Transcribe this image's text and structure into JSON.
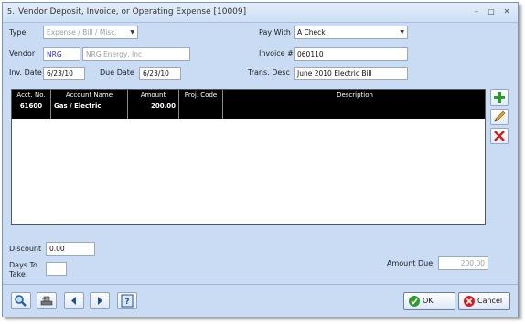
{
  "window": {
    "title": "Vendor Deposit, Invoice, or Operating Expense [10009]",
    "app_icon_glyph": "5.",
    "min_glyph": "–",
    "max_glyph": "□",
    "close_glyph": "✕"
  },
  "form": {
    "type_label": "Type",
    "type_value": "Expense / Bill / Misc.",
    "vendor_label": "Vendor",
    "vendor_code": "NRG",
    "vendor_name": "NRG Energy, Inc",
    "inv_date_label": "Inv. Date",
    "inv_date": "6/23/10",
    "due_date_label": "Due Date",
    "due_date": "6/23/10",
    "pay_with_label": "Pay With",
    "pay_with_value": "A Check",
    "invoice_label": "Invoice #",
    "invoice_value": "060110",
    "trans_desc_label": "Trans. Desc",
    "trans_desc_value": "June 2010 Electric Bill"
  },
  "grid": {
    "columns": [
      "Acct. No.",
      "Account Name",
      "Amount",
      "Proj. Code",
      "Description"
    ],
    "rows": [
      {
        "acct_no": "61600",
        "account_name": "Gas / Electric",
        "amount": "200.00",
        "proj_code": "",
        "description": ""
      }
    ]
  },
  "bottom": {
    "discount_label": "Discount",
    "discount_value": "0.00",
    "days_label_1": "Days To",
    "days_label_2": "Take",
    "days_value": "",
    "amount_due_label": "Amount Due",
    "amount_due_value": "200.00"
  },
  "buttons": {
    "ok_label": "OK",
    "cancel_label": "Cancel"
  },
  "icons": {
    "add": "add-row-icon",
    "edit": "edit-row-icon",
    "delete": "delete-row-icon",
    "search": "search-icon",
    "stamp": "stamp-icon",
    "prev": "prev-icon",
    "next": "next-icon",
    "help": "help-icon"
  },
  "colors": {
    "window_bg": "#c9dcf3",
    "grid_header_bg": "#000000",
    "add_green": "#2e9a2e",
    "delete_red": "#cc2222",
    "ok_green": "#2e9a2e",
    "cancel_red": "#cc2222"
  }
}
